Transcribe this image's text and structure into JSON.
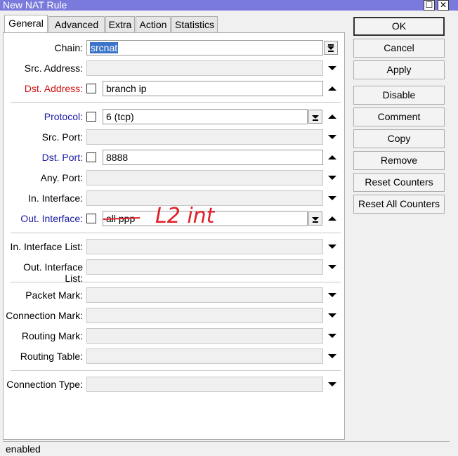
{
  "window": {
    "title": "New NAT Rule",
    "maximize_glyph": "☐",
    "close_glyph": "✕"
  },
  "tabs": [
    {
      "label": "General",
      "active": true
    },
    {
      "label": "Advanced"
    },
    {
      "label": "Extra"
    },
    {
      "label": "Action"
    },
    {
      "label": "Statistics"
    }
  ],
  "fields": {
    "chain": {
      "label": "Chain:",
      "value": "srcnat"
    },
    "src_address": {
      "label": "Src. Address:",
      "value": ""
    },
    "dst_address": {
      "label": "Dst. Address:",
      "value": "branch ip"
    },
    "protocol": {
      "label": "Protocol:",
      "value": "6 (tcp)"
    },
    "src_port": {
      "label": "Src. Port:",
      "value": ""
    },
    "dst_port": {
      "label": "Dst. Port:",
      "value": "8888"
    },
    "any_port": {
      "label": "Any. Port:",
      "value": ""
    },
    "in_interface": {
      "label": "In. Interface:",
      "value": ""
    },
    "out_interface": {
      "label": "Out. Interface:",
      "value": "all ppp",
      "annotation": "L2 int"
    },
    "in_interface_list": {
      "label": "In. Interface List:",
      "value": ""
    },
    "out_interface_list": {
      "label": "Out. Interface List:",
      "value": ""
    },
    "packet_mark": {
      "label": "Packet Mark:",
      "value": ""
    },
    "connection_mark": {
      "label": "Connection Mark:",
      "value": ""
    },
    "routing_mark": {
      "label": "Routing Mark:",
      "value": ""
    },
    "routing_table": {
      "label": "Routing Table:",
      "value": ""
    },
    "connection_type": {
      "label": "Connection Type:",
      "value": ""
    }
  },
  "buttons": {
    "ok": "OK",
    "cancel": "Cancel",
    "apply": "Apply",
    "disable": "Disable",
    "comment": "Comment",
    "copy": "Copy",
    "remove": "Remove",
    "reset_counters": "Reset Counters",
    "reset_all_counters": "Reset All Counters"
  },
  "status": "enabled",
  "colors": {
    "title_bar": "#7a7adc",
    "blue_label": "#1a1aa6",
    "red_label": "#d01010",
    "annotation_ink": "#e0202a",
    "selection": "#3b73c8"
  }
}
